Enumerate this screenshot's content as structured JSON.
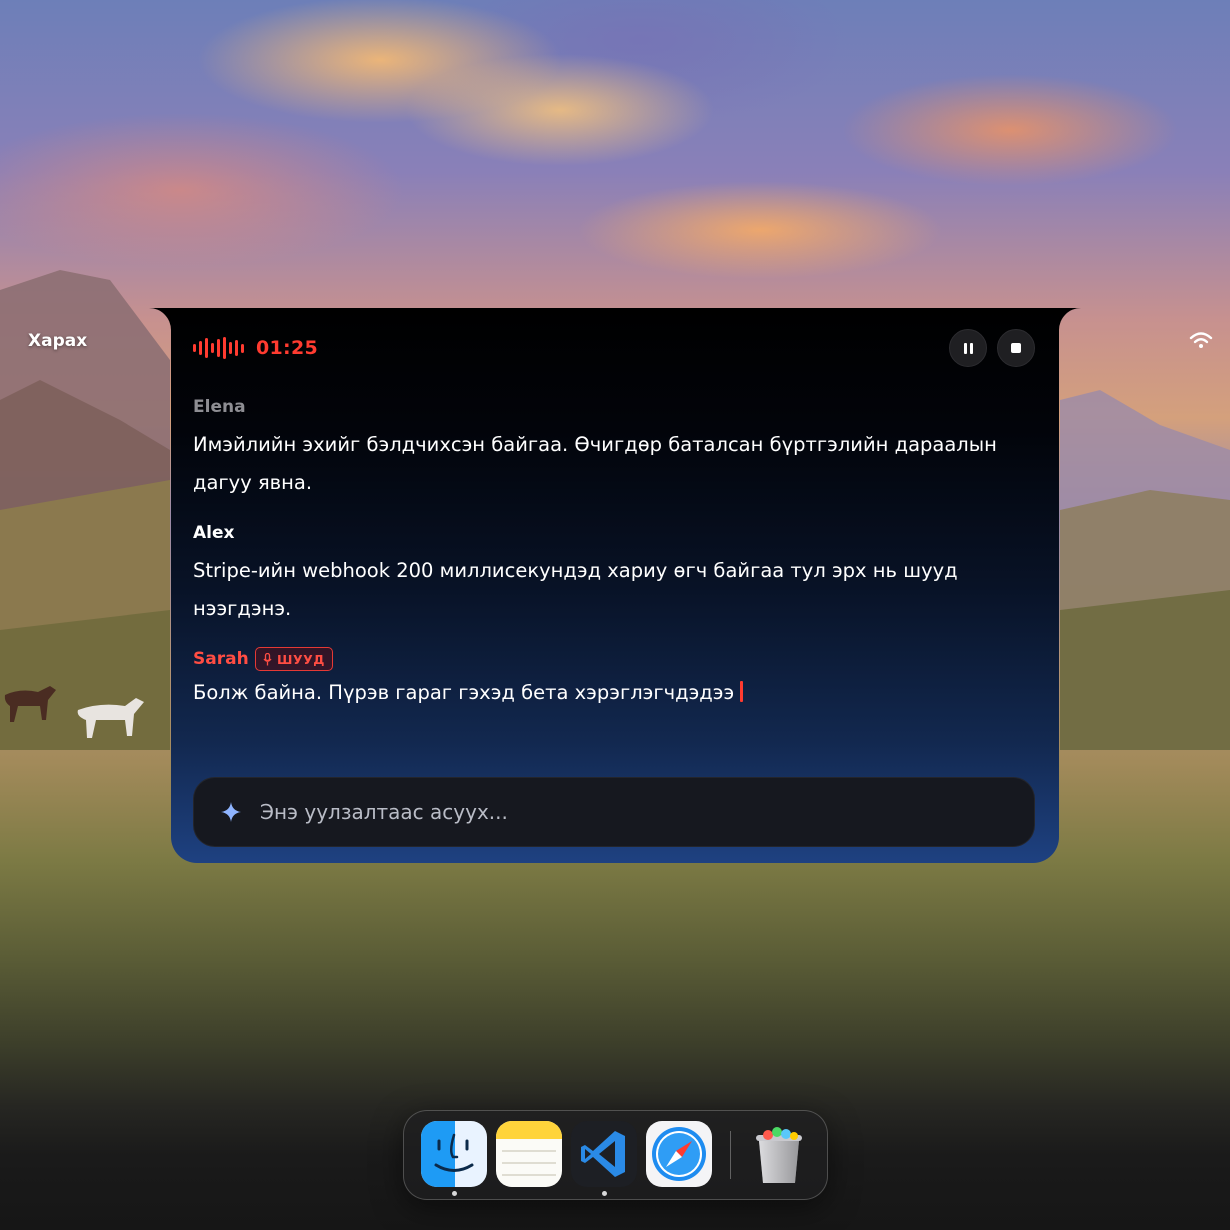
{
  "menubar": {
    "app_name": "Харах",
    "wifi_icon": "wifi-icon"
  },
  "recorder": {
    "waveform_icon": "waveform-icon",
    "elapsed": "01:25",
    "accent_color": "#ff3b30",
    "pause_icon": "pause-icon",
    "stop_icon": "stop-icon"
  },
  "transcript": [
    {
      "speaker": "Elena",
      "speaker_color": "#8e8e93",
      "text": "Имэйлийн эхийг бэлдчихсэн байгаа. Өчигдөр баталсан бүртгэлийн дараалын дагуу явна."
    },
    {
      "speaker": "Alex",
      "speaker_color": "#ffffff",
      "text": "Stripe-ийн webhook 200 миллисекундэд хариу өгч байгаа тул эрх нь шууд нээгдэнэ."
    },
    {
      "speaker": "Sarah",
      "speaker_color": "#ff4d43",
      "live_badge": "ШУУД",
      "text": "Болж байна. Пүрэв гараг гэхэд бета хэрэглэгчдэдээ"
    }
  ],
  "ask": {
    "icon": "sparkle-icon",
    "placeholder": "Энэ уулзалтаас асуух..."
  },
  "dock": {
    "apps": [
      {
        "name": "finder-icon",
        "running": true
      },
      {
        "name": "notes-icon",
        "running": false
      },
      {
        "name": "vscode-icon",
        "running": true
      },
      {
        "name": "safari-icon",
        "running": false
      },
      {
        "name": "trash-icon",
        "running": false
      }
    ]
  }
}
